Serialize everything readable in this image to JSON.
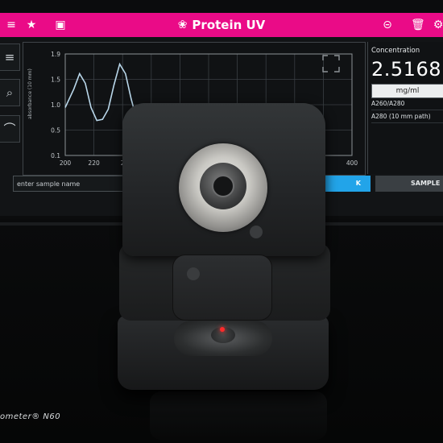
{
  "app": {
    "title": "Protein UV",
    "brand_color": "#ea0b87"
  },
  "topbar_icons": [
    "menu-icon",
    "star-icon",
    "save-icon",
    "logo-icon",
    "link-icon",
    "trash-icon",
    "settings-icon"
  ],
  "sample": {
    "placeholder": "enter sample name",
    "blank_label": "K",
    "sample_label": "SAMPLE"
  },
  "concentration": {
    "title": "Concentration",
    "value": "2.5168",
    "unit": "mg/ml",
    "rows": [
      "A260/A280",
      "A280 (10 mm path)"
    ]
  },
  "chart_data": {
    "type": "line",
    "ylabel": "absorbance (10 mm)",
    "xlabel": "",
    "ylim": [
      0.1,
      1.9
    ],
    "xlim": [
      200,
      400
    ],
    "y_ticks": [
      "1.9",
      "1.5",
      "1.0",
      "0.5",
      "0.1"
    ],
    "x_ticks": [
      "200",
      "220",
      "2",
      "400"
    ],
    "series": [
      {
        "x": [
          200,
          206,
          210,
          214,
          218,
          222,
          226,
          230,
          234,
          238,
          242,
          246,
          250
        ],
        "y": [
          0.95,
          1.28,
          1.55,
          1.38,
          0.95,
          0.72,
          0.74,
          0.92,
          1.35,
          1.72,
          1.55,
          1.1,
          0.72
        ]
      }
    ]
  },
  "device": {
    "brand_text": "ometer® N60"
  }
}
